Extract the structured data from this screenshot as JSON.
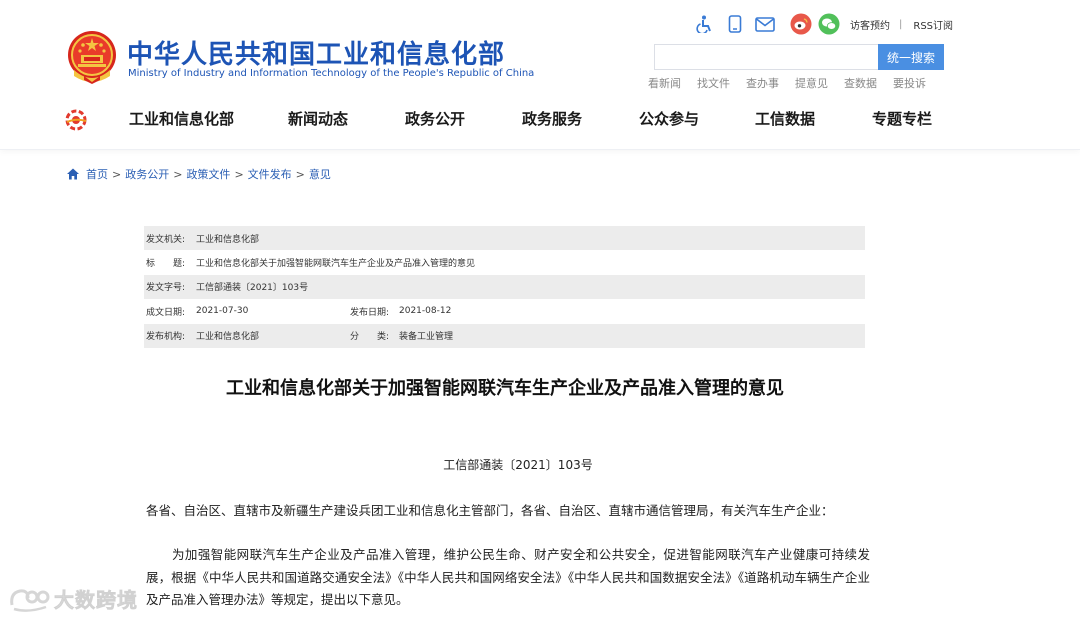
{
  "header": {
    "site_title": "中华人民共和国工业和信息化部",
    "site_subtitle": "Ministry of Industry and Information Technology of the People's Republic of China",
    "utils": {
      "visit_label": "访客预约",
      "separator": "|",
      "rss_label": "RSS订阅",
      "icons": [
        "accessibility-icon",
        "mobile-icon",
        "mail-icon",
        "weibo-icon",
        "wechat-icon"
      ]
    },
    "search": {
      "placeholder": "",
      "button_label": "统一搜索"
    },
    "quick_links": [
      "看新闻",
      "找文件",
      "查办事",
      "提意见",
      "查数据",
      "要投诉"
    ],
    "nav": [
      "工业和信息化部",
      "新闻动态",
      "政务公开",
      "政务服务",
      "公众参与",
      "工信数据",
      "专题专栏"
    ]
  },
  "breadcrumb": [
    "首页",
    "政务公开",
    "政策文件",
    "文件发布",
    "意见"
  ],
  "breadcrumb_separator": ">",
  "info": {
    "issuer_label": "发文机关:",
    "issuer": "工业和信息化部",
    "title_label": "标　　题:",
    "title": "工业和信息化部关于加强智能网联汽车生产企业及产品准入管理的意见",
    "doc_no_label": "发文字号:",
    "doc_no": "工信部通装〔2021〕103号",
    "written_date_label": "成文日期:",
    "written_date": "2021-07-30",
    "publish_date_label": "发布日期:",
    "publish_date": "2021-08-12",
    "publisher_label": "发布机构:",
    "publisher": "工业和信息化部",
    "category_label": "分　　类:",
    "category": "装备工业管理"
  },
  "article": {
    "title": "工业和信息化部关于加强智能网联汽车生产企业及产品准入管理的意见",
    "doc_number": "工信部通装〔2021〕103号",
    "addressee": "各省、自治区、直辖市及新疆生产建设兵团工业和信息化主管部门，各省、自治区、直辖市通信管理局，有关汽车生产企业：",
    "paragraph_1": "为加强智能网联汽车生产企业及产品准入管理，维护公民生命、财产安全和公共安全，促进智能网联汽车产业健康可持续发展，根据《中华人民共和国道路交通安全法》《中华人民共和国网络安全法》《中华人民共和国数据安全法》《道路机动车辆生产企业及产品准入管理办法》等规定，提出以下意见。"
  },
  "watermark": {
    "text": "大数跨境"
  },
  "colors": {
    "brand_blue": "#1d54b5",
    "search_blue": "#4a8fe2",
    "row_gray": "#ececec"
  }
}
